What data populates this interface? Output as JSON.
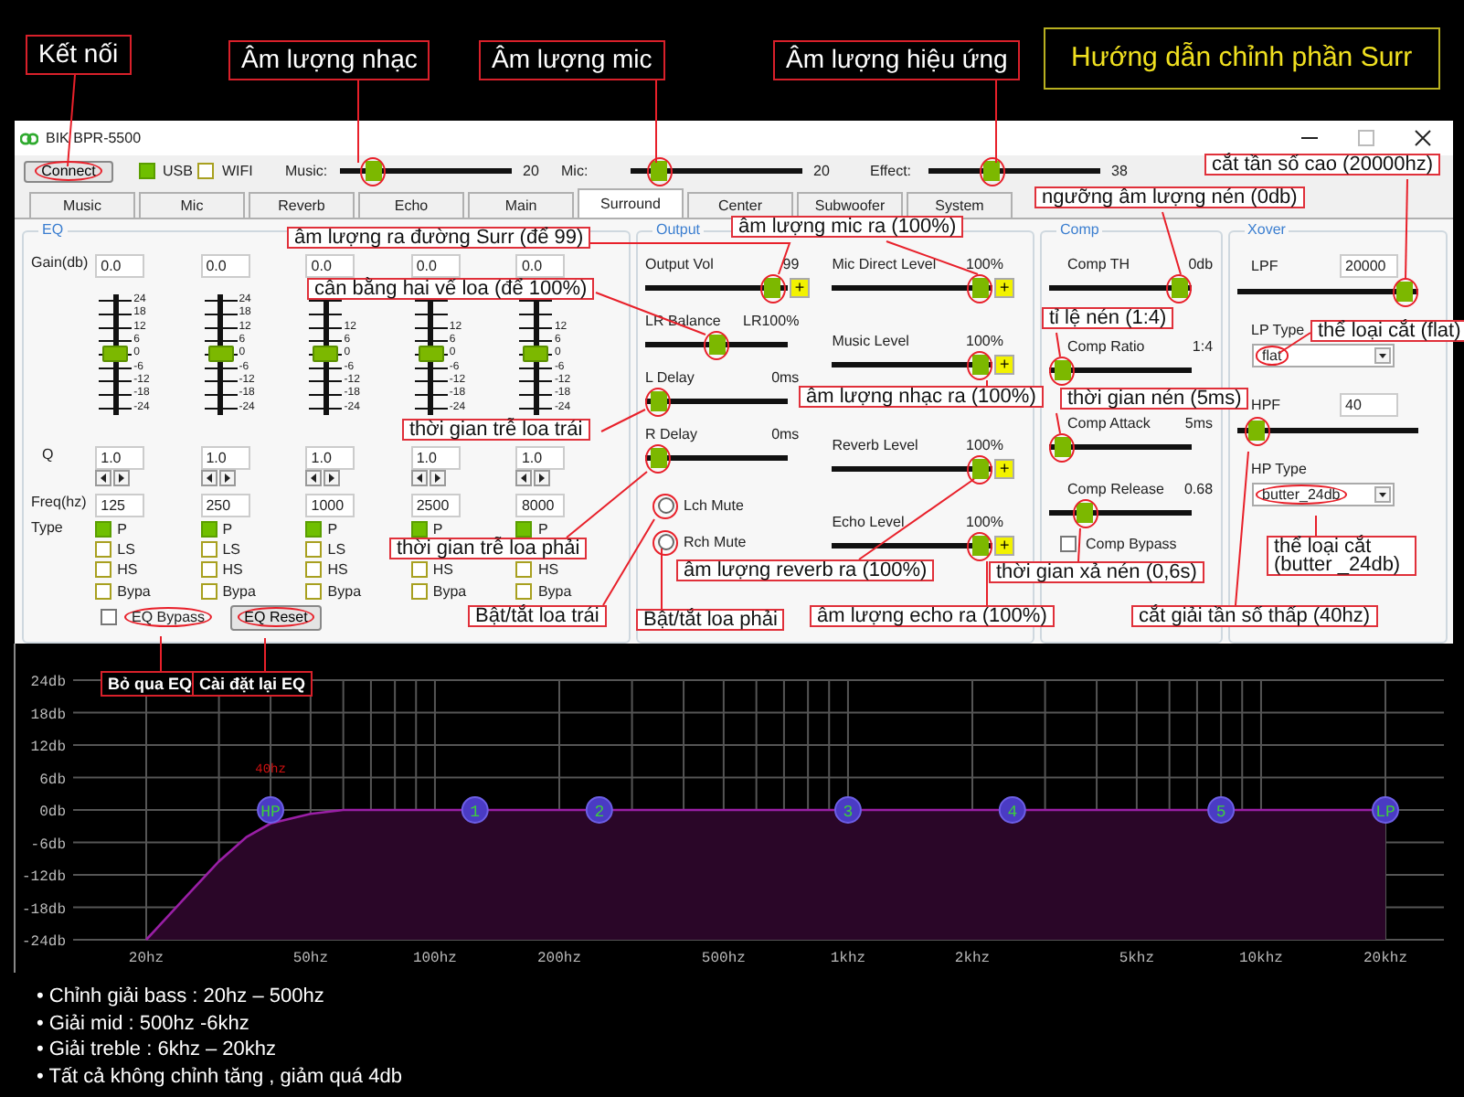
{
  "annotations": [
    {
      "kind": "header",
      "text": "Kết nối"
    },
    {
      "kind": "header",
      "text": "Âm lượng nhạc"
    },
    {
      "kind": "header",
      "text": "Âm lượng mic"
    },
    {
      "kind": "header",
      "text": "Âm lượng hiệu ứng"
    },
    {
      "kind": "title",
      "text": "Hướng dẫn chỉnh phần Surr"
    },
    {
      "kind": "callout",
      "text": "cắt tần số cao (20000hz)"
    },
    {
      "kind": "callout",
      "text": "ngưỡng âm lượng nén (0db)"
    },
    {
      "kind": "callout",
      "text": "âm lượng mic ra (100%)"
    },
    {
      "kind": "callout",
      "text": "âm lượng ra đường Surr (để 99)"
    },
    {
      "kind": "callout",
      "text": "cân bằng hai vế loa (để 100%)"
    },
    {
      "kind": "callout",
      "text": "tỉ lệ nén (1:4)"
    },
    {
      "kind": "callout",
      "text": "thể loại cắt (flat)"
    },
    {
      "kind": "callout",
      "text": "âm lượng nhạc ra (100%)"
    },
    {
      "kind": "callout",
      "text": "thời gian nén (5ms)"
    },
    {
      "kind": "callout",
      "text": "thời gian trễ loa trái"
    },
    {
      "kind": "callout",
      "text": "thời gian trễ loa phải"
    },
    {
      "kind": "callout",
      "text": "âm lượng reverb ra (100%)"
    },
    {
      "kind": "callout",
      "text": "thời gian xả nén (0,6s)"
    },
    {
      "kind": "callout",
      "text": "thể loại cắt (butter _24db)"
    },
    {
      "kind": "callout",
      "text": "Bật/tắt loa trái"
    },
    {
      "kind": "callout",
      "text": "Bật/tắt loa phải"
    },
    {
      "kind": "callout",
      "text": "âm lượng echo ra (100%)"
    },
    {
      "kind": "callout",
      "text": "cắt giải tần số thấp (40hz)"
    },
    {
      "kind": "tag",
      "text": "Bỏ qua EQ"
    },
    {
      "kind": "tag",
      "text": "Cài đặt lại EQ"
    }
  ],
  "window": {
    "title": "BIK BPR-5500",
    "toolbar": {
      "connect": {
        "label": "Connect",
        "highlighted": true
      },
      "usb": {
        "label": "USB",
        "on": true
      },
      "wifi": {
        "label": "WIFI",
        "checked": false
      },
      "sliders": [
        {
          "label": "Music:",
          "level": 0.14,
          "reading": "20",
          "highlighted": true
        },
        {
          "label": "Mic:",
          "level": 0.11,
          "reading": "20",
          "highlighted": true
        },
        {
          "label": "Effect:",
          "level": 0.35,
          "reading": "38",
          "highlighted": true
        }
      ]
    },
    "tabs": [
      {
        "label": "Music",
        "selected": false
      },
      {
        "label": "Mic",
        "selected": false
      },
      {
        "label": "Reverb",
        "selected": false
      },
      {
        "label": "Echo",
        "selected": false
      },
      {
        "label": "Main",
        "selected": false
      },
      {
        "label": "Surround",
        "selected": true
      },
      {
        "label": "Center",
        "selected": false
      },
      {
        "label": "Subwoofer",
        "selected": false
      },
      {
        "label": "System",
        "selected": false
      }
    ],
    "eq": {
      "legend": "EQ",
      "row_labels": [
        "Gain(db)",
        "Q",
        "Freq(hz)",
        "Type"
      ],
      "bands": [
        {
          "gain": "0.0",
          "level": 0.5,
          "scale": [
            "24",
            "18",
            "12",
            "6",
            "0",
            "-6",
            "-12",
            "-18",
            "-24"
          ],
          "q": "1.0",
          "freq": "125",
          "types": [
            {
              "kind": "p",
              "label": "P",
              "selected": true
            },
            {
              "kind": "ls",
              "label": "LS",
              "selected": false
            },
            {
              "kind": "hs",
              "label": "HS",
              "selected": false
            },
            {
              "kind": "bypass",
              "label": "Bypa",
              "selected": false
            }
          ]
        },
        {
          "gain": "0.0",
          "level": 0.5,
          "scale": [
            "24",
            "18",
            "12",
            "6",
            "0",
            "-6",
            "-12",
            "-18",
            "-24"
          ],
          "q": "1.0",
          "freq": "250",
          "types": [
            {
              "kind": "p",
              "label": "P",
              "selected": true
            },
            {
              "kind": "ls",
              "label": "LS",
              "selected": false
            },
            {
              "kind": "hs",
              "label": "HS",
              "selected": false
            },
            {
              "kind": "bypass",
              "label": "Bypa",
              "selected": false
            }
          ]
        },
        {
          "gain": "0.0",
          "level": 0.5,
          "scale": [
            "12",
            "6",
            "0",
            "-6",
            "-12",
            "-18",
            "-24"
          ],
          "q": "1.0",
          "freq": "1000",
          "types": [
            {
              "kind": "p",
              "label": "P",
              "selected": true
            },
            {
              "kind": "ls",
              "label": "LS",
              "selected": false
            },
            {
              "kind": "hs",
              "label": "HS",
              "selected": false
            },
            {
              "kind": "bypass",
              "label": "Bypa",
              "selected": false
            }
          ]
        },
        {
          "gain": "0.0",
          "level": 0.5,
          "scale": [
            "12",
            "6",
            "0",
            "-6",
            "-12",
            "-18",
            "-24"
          ],
          "q": "1.0",
          "freq": "2500",
          "types": [
            {
              "kind": "p",
              "label": "P",
              "selected": true
            },
            {
              "kind": "hs",
              "label": "HS",
              "selected": false
            },
            {
              "kind": "bypass",
              "label": "Bypa",
              "selected": false
            }
          ]
        },
        {
          "gain": "0.0",
          "level": 0.5,
          "scale": [
            "12",
            "6",
            "0",
            "-6",
            "-12",
            "-18",
            "-24"
          ],
          "q": "1.0",
          "freq": "8000",
          "types": [
            {
              "kind": "p",
              "label": "P",
              "selected": true
            },
            {
              "kind": "hs",
              "label": "HS",
              "selected": false
            },
            {
              "kind": "bypass",
              "label": "Bypa",
              "selected": false
            }
          ]
        }
      ],
      "bypass": {
        "label": "EQ Bypass",
        "checked": false,
        "highlighted": true
      },
      "reset": {
        "label": "EQ Reset",
        "highlighted": true
      }
    },
    "output": {
      "legend": "Output",
      "left": [
        {
          "kind": "slider",
          "label": "Output Vol",
          "reading": "99",
          "level": 0.98,
          "plus": "+",
          "highlighted": true
        },
        {
          "kind": "slider",
          "label": "LR Balance",
          "reading": "LR100%",
          "level": 0.5,
          "highlighted": true
        },
        {
          "kind": "slider",
          "label": "L Delay",
          "reading": "0ms",
          "level": 0,
          "highlighted": true
        },
        {
          "kind": "slider",
          "label": "R Delay",
          "reading": "0ms",
          "level": 0,
          "highlighted": true
        },
        {
          "kind": "radio",
          "label": "Lch Mute",
          "checked": false,
          "highlighted": true
        },
        {
          "kind": "radio",
          "label": "Rch Mute",
          "checked": false,
          "highlighted": true
        }
      ],
      "right": [
        {
          "kind": "slider",
          "label": "Mic Direct Level",
          "reading": "100%",
          "level": 1,
          "plus": "+",
          "highlighted": true
        },
        {
          "kind": "slider",
          "label": "Music Level",
          "reading": "100%",
          "level": 1,
          "plus": "+",
          "highlighted": true
        },
        {
          "kind": "slider",
          "label": "Reverb Level",
          "reading": "100%",
          "level": 1,
          "plus": "+",
          "highlighted": true
        },
        {
          "kind": "slider",
          "label": "Echo Level",
          "reading": "100%",
          "level": 1,
          "plus": "+",
          "highlighted": true
        }
      ]
    },
    "comp": {
      "legend": "Comp",
      "items": [
        {
          "kind": "slider",
          "label": "Comp TH",
          "reading": "0db",
          "level": 1,
          "highlighted": true
        },
        {
          "kind": "slider",
          "label": "Comp Ratio",
          "reading": "1:4",
          "level": 0,
          "highlighted": true
        },
        {
          "kind": "slider",
          "label": "Comp Attack",
          "reading": "5ms",
          "level": 0,
          "highlighted": true
        },
        {
          "kind": "slider",
          "label": "Comp Release",
          "reading": "0.68",
          "level": 0.2,
          "highlighted": true
        },
        {
          "kind": "checkbox",
          "label": "Comp Bypass",
          "checked": false
        }
      ]
    },
    "xover": {
      "legend": "Xover",
      "items": [
        {
          "kind": "freq",
          "label": "LPF",
          "value": "20000",
          "level": 1,
          "highlighted": true
        },
        {
          "kind": "select",
          "label": "LP Type",
          "value": "flat",
          "highlighted": true
        },
        {
          "kind": "freq",
          "label": "HPF",
          "value": "40",
          "level": 0.05,
          "highlighted": true
        },
        {
          "kind": "select",
          "label": "HP Type",
          "value": "butter_24db",
          "highlighted": true
        }
      ]
    }
  },
  "eq_graph": {
    "y_labels": [
      "24db",
      "18db",
      "12db",
      "6db",
      "0db",
      "-6db",
      "-12db",
      "-18db",
      "-24db"
    ],
    "x_labels": [
      "20hz",
      "50hz",
      "100hz",
      "200hz",
      "500hz",
      "1khz",
      "2khz",
      "5khz",
      "10khz",
      "20khz"
    ],
    "marker_label": "40hz",
    "nodes": [
      {
        "label": "HP"
      },
      {
        "label": "1"
      },
      {
        "label": "2"
      },
      {
        "label": "3"
      },
      {
        "label": "4"
      },
      {
        "label": "5"
      },
      {
        "label": "LP"
      }
    ]
  },
  "notes": [
    "• Chỉnh giải bass : 20hz – 500hz",
    "• Giải mid : 500hz -6khz",
    "• Giải treble : 6khz – 20khz",
    "• Tất cả không chỉnh tăng , giảm quá 4db"
  ]
}
